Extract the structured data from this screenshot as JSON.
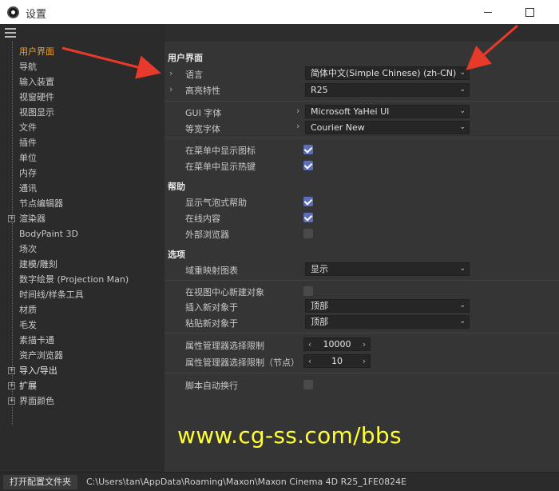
{
  "window": {
    "title": "设置",
    "minimize_icon": "minimize-icon",
    "maximize_icon": "maximize-icon"
  },
  "sidebar": {
    "items": [
      {
        "label": "用户界面",
        "state": "active"
      },
      {
        "label": "导航"
      },
      {
        "label": "输入装置"
      },
      {
        "label": "视窗硬件"
      },
      {
        "label": "视图显示"
      },
      {
        "label": "文件"
      },
      {
        "label": "插件"
      },
      {
        "label": "单位"
      },
      {
        "label": "内存"
      },
      {
        "label": "通讯"
      },
      {
        "label": "节点编辑器"
      },
      {
        "label": "渲染器",
        "expandable": true
      },
      {
        "label": "BodyPaint 3D"
      },
      {
        "label": "场次"
      },
      {
        "label": "建模/雕刻"
      },
      {
        "label": "数字绘景 (Projection Man)"
      },
      {
        "label": "时间线/样条工具"
      },
      {
        "label": "材质"
      },
      {
        "label": "毛发"
      },
      {
        "label": "素描卡通"
      },
      {
        "label": "资产浏览器"
      },
      {
        "label": "导入/导出",
        "expandable": true,
        "group": true
      },
      {
        "label": "扩展",
        "expandable": true,
        "group": true
      },
      {
        "label": "界面颜色",
        "expandable": true
      }
    ]
  },
  "main": {
    "sections": {
      "ui": "用户界面",
      "help": "帮助",
      "options": "选项"
    },
    "ui": {
      "language_label": "语言",
      "language_value": "简体中文(Simple Chinese) (zh-CN)",
      "highlight_label": "高亮特性",
      "highlight_value": "R25",
      "gui_font_label": "GUI 字体",
      "gui_font_value": "Microsoft YaHei UI",
      "mono_font_label": "等宽字体",
      "mono_font_value": "Courier New",
      "menu_icons_label": "在菜单中显示图标",
      "menu_icons_checked": true,
      "menu_hotkeys_label": "在菜单中显示热键",
      "menu_hotkeys_checked": true
    },
    "help": {
      "bubble_label": "显示气泡式帮助",
      "bubble_checked": true,
      "online_label": "在线内容",
      "online_checked": true,
      "external_label": "外部浏览器",
      "external_checked": false
    },
    "options": {
      "domain_label": "域重映射图表",
      "domain_value": "显示",
      "create_center_label": "在视图中心新建对象",
      "create_center_checked": false,
      "insert_label": "插入新对象于",
      "insert_value": "顶部",
      "paste_label": "粘贴新对象于",
      "paste_value": "顶部",
      "attr_limit_label": "属性管理器选择限制",
      "attr_limit_value": "10000",
      "attr_limit_node_label": "属性管理器选择限制（节点）",
      "attr_limit_node_value": "10",
      "script_wrap_label": "脚本自动换行",
      "script_wrap_checked": false
    }
  },
  "watermark": "www.cg-ss.com/bbs",
  "statusbar": {
    "open_folder_label": "打开配置文件夹",
    "path": "C:\\Users\\tan\\AppData\\Roaming\\Maxon\\Maxon Cinema 4D R25_1FE0824E"
  },
  "colors": {
    "accent": "#f0a030",
    "checkbox": "#5a6fb8",
    "arrow": "#e83a2a",
    "watermark": "#ffff33"
  }
}
